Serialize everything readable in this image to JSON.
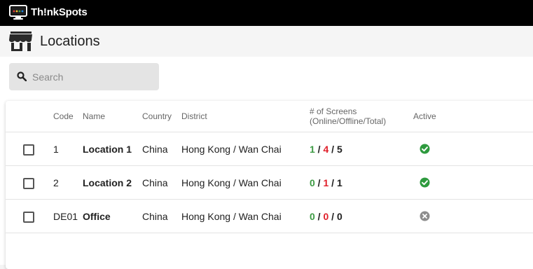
{
  "app": {
    "brand": "Th!nkSpots"
  },
  "header": {
    "title": "Locations"
  },
  "search": {
    "placeholder": "Search"
  },
  "table": {
    "columns": {
      "code": "Code",
      "name": "Name",
      "country": "Country",
      "district": "District",
      "screens_line1": "# of Screens",
      "screens_line2": "(Online/Offline/Total)",
      "active": "Active"
    },
    "rows": [
      {
        "code": "1",
        "name": "Location 1",
        "country": "China",
        "district": "Hong Kong / Wan Chai",
        "online": "1",
        "offline": "4",
        "total": "5",
        "active": "active-check-icon"
      },
      {
        "code": "2",
        "name": "Location 2",
        "country": "China",
        "district": "Hong Kong / Wan Chai",
        "online": "0",
        "offline": "1",
        "total": "1",
        "active": "active-check-icon"
      },
      {
        "code": "DE01",
        "name": "Office",
        "country": "China",
        "district": "Hong Kong / Wan Chai",
        "online": "0",
        "offline": "0",
        "total": "0",
        "active": "inactive-x-icon"
      }
    ],
    "separator": " / "
  },
  "colors": {
    "online": "#3c9a43",
    "offline": "#e0202b",
    "active": "#2e9a3e",
    "inactive": "#8d8d8d",
    "topbar": "#000000"
  }
}
